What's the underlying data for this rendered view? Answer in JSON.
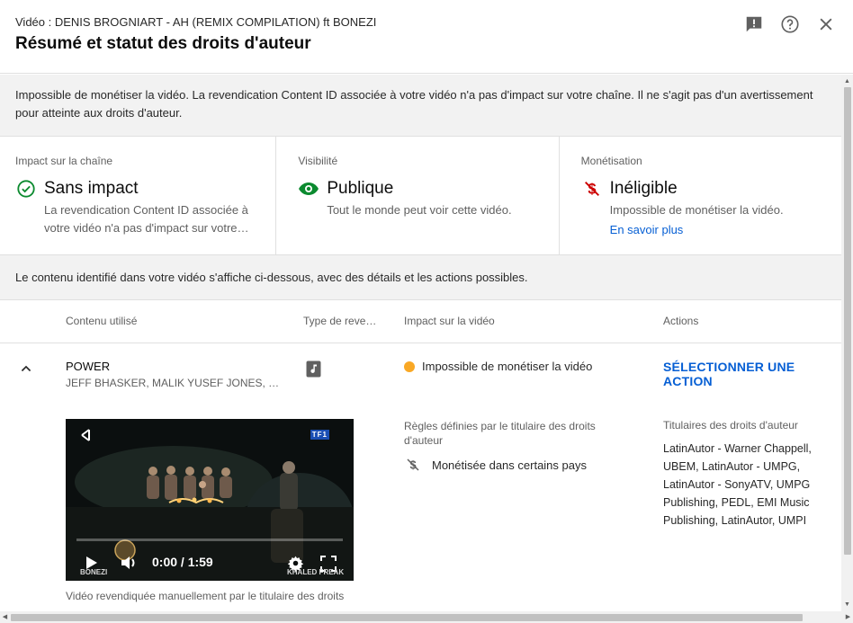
{
  "header": {
    "subtitle": "Vidéo : DENIS BROGNIART - AH (REMIX COMPILATION) ft BONEZI",
    "title": "Résumé et statut des droits d'auteur",
    "icons": [
      "feedback-icon",
      "help-icon",
      "close-icon"
    ]
  },
  "banner": {
    "text": "Impossible de monétiser la vidéo. La revendication Content ID associée à votre vidéo n'a pas d'impact sur votre chaîne. Il ne s'agit pas d'un avertissement pour atteinte aux droits d'auteur."
  },
  "status": {
    "impact": {
      "label": "Impact sur la chaîne",
      "value": "Sans impact",
      "desc": "La revendication Content ID associée à votre vidéo n'a pas d'impact sur votre…",
      "color": "#0f9d58"
    },
    "visibility": {
      "label": "Visibilité",
      "value": "Publique",
      "desc": "Tout le monde peut voir cette vidéo.",
      "color": "#0b8a2f"
    },
    "monetization": {
      "label": "Monétisation",
      "value": "Inéligible",
      "desc": "Impossible de monétiser la vidéo.",
      "link": "En savoir plus",
      "color": "#cc0000"
    }
  },
  "info_bar": {
    "text": "Le contenu identifié dans votre vidéo s'affiche ci-dessous, avec des détails et les actions possibles."
  },
  "table": {
    "headers": {
      "content": "Contenu utilisé",
      "type": "Type de reve…",
      "impact": "Impact sur la vidéo",
      "actions": "Actions"
    },
    "row": {
      "title": "POWER",
      "authors": "JEFF BHASKER, MALIK YUSEF JONES, B…",
      "impact": "Impossible de monétiser la vidéo",
      "impact_color": "#f9a825",
      "action": "SÉLECTIONNER UNE ACTION",
      "video": {
        "time": "0:00 / 1:59",
        "progress": 0,
        "logo": "TF1",
        "watermark_left": "BONEZI",
        "watermark_right": "KHALED FREAK"
      },
      "rules_label": "Règles définies par le titulaire des droits d'auteur",
      "rules_item": "Monétisée dans certains pays",
      "owners_label": "Titulaires des droits d'auteur",
      "owners": "LatinAutor - Warner Chappell, UBEM, LatinAutor - UMPG, LatinAutor - SonyATV, UMPG Publishing, PEDL, EMI Music Publishing, LatinAutor, UMPI",
      "claim_note": "Vidéo revendiquée manuellement par le titulaire des droits"
    }
  }
}
